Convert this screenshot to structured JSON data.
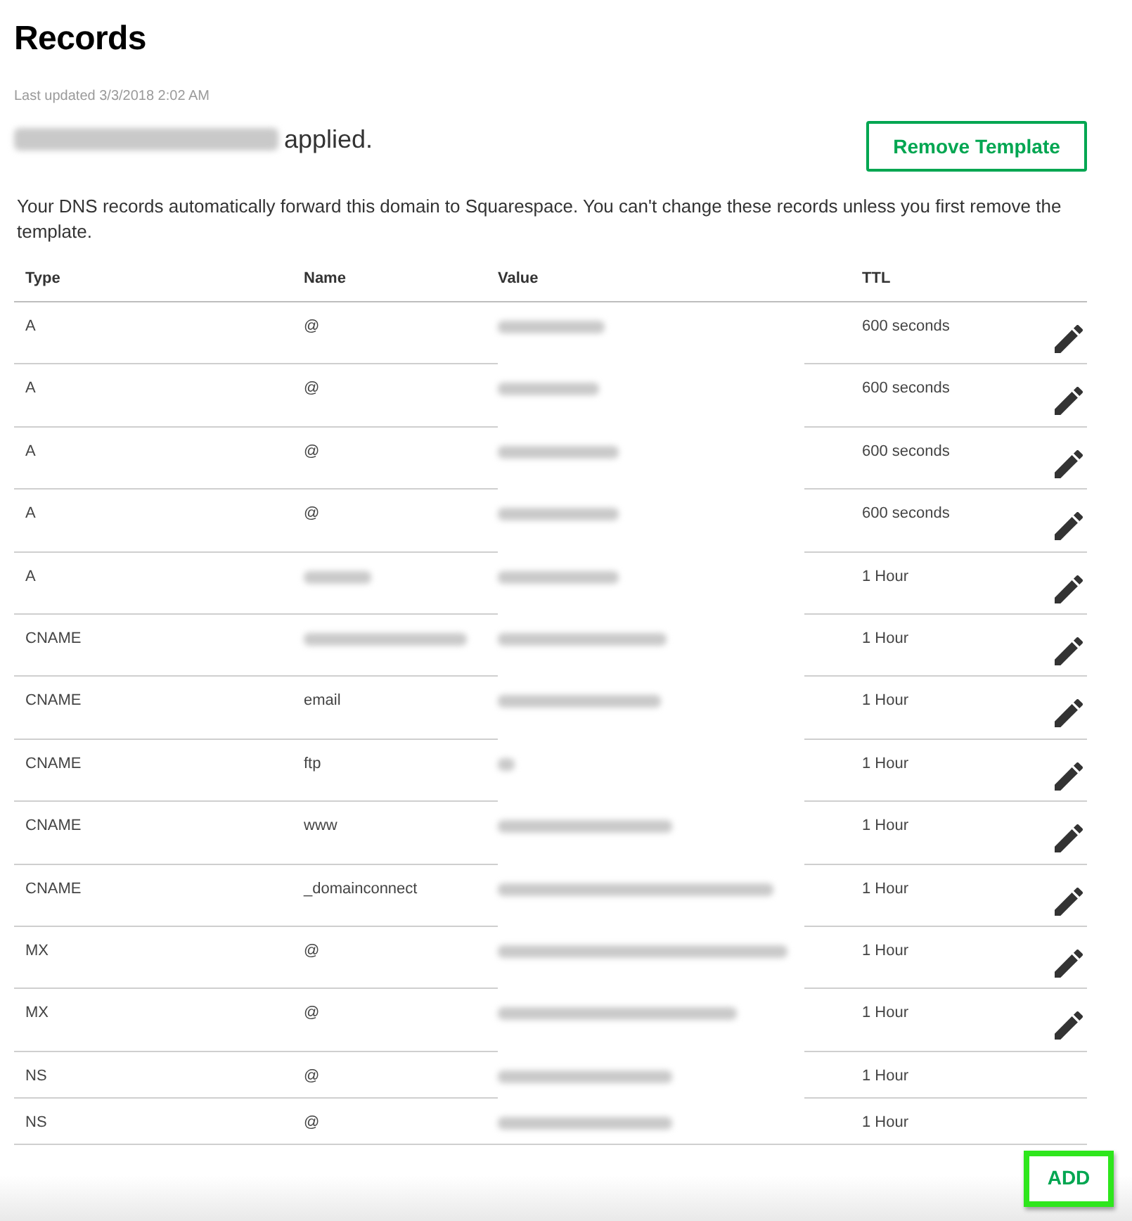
{
  "page": {
    "title": "Records",
    "last_updated": "Last updated 3/3/2018 2:02 AM"
  },
  "template_notice": {
    "template_name_blurred": true,
    "text": "applied.",
    "button": "Remove Template"
  },
  "description": "Your DNS records automatically forward this domain to Squarespace. You can't change these records unless you first remove the template.",
  "table": {
    "columns": [
      "Type",
      "Name",
      "Value",
      "TTL"
    ],
    "rows": [
      {
        "type": "A",
        "name": "@",
        "name_blurred": false,
        "value_blurred": true,
        "ttl": "600 seconds",
        "editable": true
      },
      {
        "type": "A",
        "name": "@",
        "name_blurred": false,
        "value_blurred": true,
        "ttl": "600 seconds",
        "editable": true
      },
      {
        "type": "A",
        "name": "@",
        "name_blurred": false,
        "value_blurred": true,
        "ttl": "600 seconds",
        "editable": true
      },
      {
        "type": "A",
        "name": "@",
        "name_blurred": false,
        "value_blurred": true,
        "ttl": "600 seconds",
        "editable": true
      },
      {
        "type": "A",
        "name_blurred": true,
        "value_blurred": true,
        "ttl": "1 Hour",
        "editable": true
      },
      {
        "type": "CNAME",
        "name_blurred": true,
        "value_blurred": true,
        "ttl": "1 Hour",
        "editable": true
      },
      {
        "type": "CNAME",
        "name": "email",
        "name_blurred": false,
        "value_blurred": true,
        "ttl": "1 Hour",
        "editable": true
      },
      {
        "type": "CNAME",
        "name": "ftp",
        "name_blurred": false,
        "value_blurred": true,
        "ttl": "1 Hour",
        "editable": true
      },
      {
        "type": "CNAME",
        "name": "www",
        "name_blurred": false,
        "value_blurred": true,
        "ttl": "1 Hour",
        "editable": true
      },
      {
        "type": "CNAME",
        "name": "_domainconnect",
        "name_blurred": false,
        "value_blurred": true,
        "ttl": "1 Hour",
        "editable": true
      },
      {
        "type": "MX",
        "name": "@",
        "name_blurred": false,
        "value_blurred": true,
        "ttl": "1 Hour",
        "editable": true
      },
      {
        "type": "MX",
        "name": "@",
        "name_blurred": false,
        "value_blurred": true,
        "ttl": "1 Hour",
        "editable": true
      },
      {
        "type": "NS",
        "name": "@",
        "name_blurred": false,
        "value_blurred": true,
        "ttl": "1 Hour",
        "editable": false
      },
      {
        "type": "NS",
        "name": "@",
        "name_blurred": false,
        "value_blurred": true,
        "ttl": "1 Hour",
        "editable": false
      }
    ]
  },
  "add_button": {
    "label": "ADD",
    "highlighted": true
  }
}
